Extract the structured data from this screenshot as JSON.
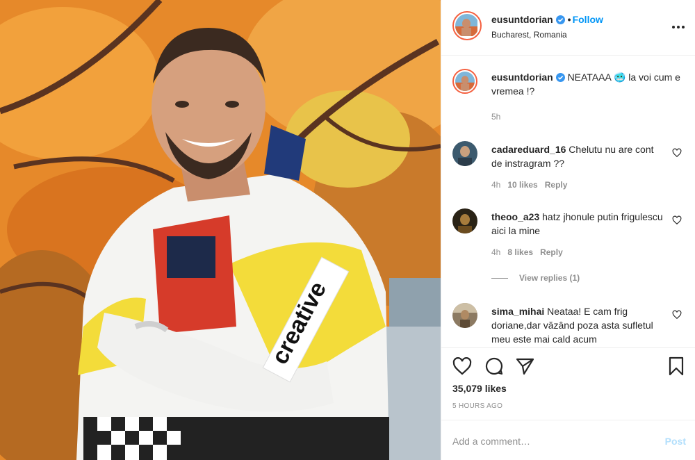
{
  "post": {
    "username": "eusuntdorian",
    "location": "Bucharest, Romania",
    "follow_label": "Follow",
    "separator": "•",
    "photo_jacket_text": "creative",
    "caption": {
      "username": "eusuntdorian",
      "text": "NEATAAA 🥶 la voi cum e vremea !?",
      "time": "5h"
    },
    "comments": [
      {
        "username": "cadareduard_16",
        "text": "Chelutu nu are cont de instragram ??",
        "time": "4h",
        "likes": "10 likes",
        "reply": "Reply"
      },
      {
        "username": "theoo_a23",
        "text": "hatz jhonule putin frigulescu aici la mine",
        "time": "4h",
        "likes": "8 likes",
        "reply": "Reply"
      },
      {
        "username": "sima_mihai",
        "text": "Neataa! E cam frig doriane,dar văzând poza asta sufletul meu este mai cald acum",
        "time": "",
        "likes": "",
        "reply": ""
      }
    ],
    "view_replies": "View replies (1)",
    "likes": "35,079 likes",
    "posted_ago": "5 hours ago",
    "add_comment_placeholder": "Add a comment…",
    "post_label": "Post"
  },
  "icons": {
    "verified": "verified-badge-icon",
    "more": "more-options-icon",
    "like": "heart-icon",
    "comment": "comment-icon",
    "share": "paper-plane-icon",
    "save": "bookmark-icon"
  },
  "colors": {
    "link": "#0095f6",
    "muted": "#8e8e8e",
    "text": "#262626",
    "post_disabled": "#b2dffc",
    "story_ring": "#f56040"
  }
}
